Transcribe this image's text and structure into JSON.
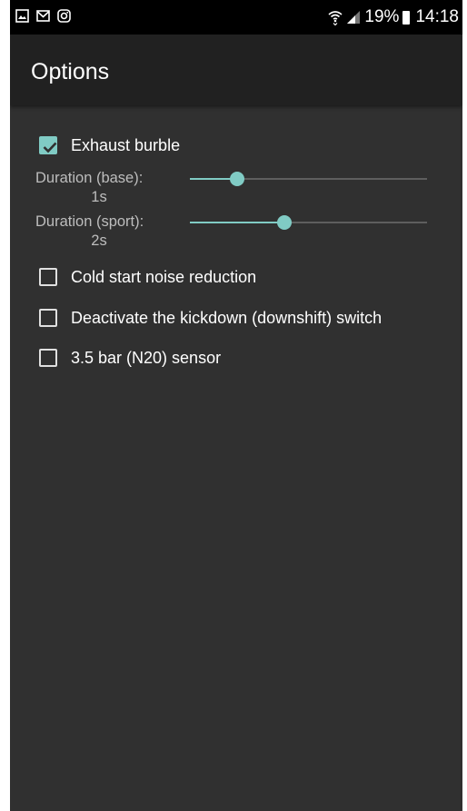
{
  "status_bar": {
    "left_icons": [
      "gallery-icon",
      "gmail-icon",
      "instagram-icon"
    ],
    "wifi_icon": "wifi-icon",
    "signal_icon": "signal-icon",
    "battery": "19%",
    "time": "14:18"
  },
  "app_bar": {
    "title": "Options"
  },
  "options": {
    "exhaust_burble": {
      "label": "Exhaust burble",
      "checked": true
    },
    "duration_base": {
      "label": "Duration (base):",
      "value": "1s",
      "level": 0.2
    },
    "duration_sport": {
      "label": "Duration (sport):",
      "value": "2s",
      "level": 0.4
    },
    "cold_start": {
      "label": "Cold start noise reduction",
      "checked": false
    },
    "kickdown": {
      "label": "Deactivate the kickdown (downshift) switch",
      "checked": false
    },
    "sensor": {
      "label": "3.5 bar (N20) sensor",
      "checked": false
    }
  },
  "colors": {
    "accent": "#80cbc4",
    "background": "#303030",
    "app_bar": "#212121",
    "status_bar": "#000000"
  }
}
